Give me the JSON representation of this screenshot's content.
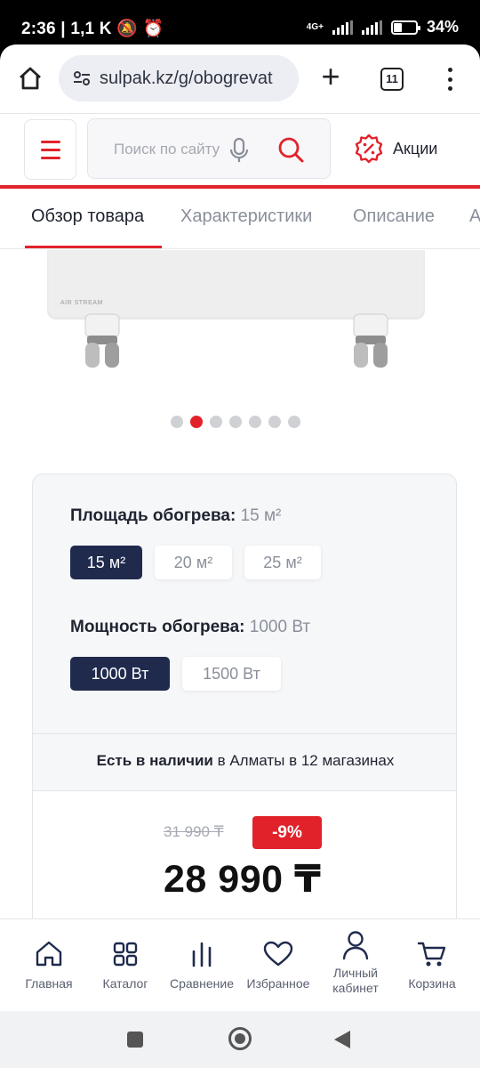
{
  "status_bar": {
    "time": "2:36",
    "network_speed": "1,1 K",
    "network_type": "4G+",
    "battery": "34%"
  },
  "browser": {
    "url": "sulpak.kz/g/obogrevat",
    "tab_count": "11"
  },
  "header": {
    "search_placeholder": "Поиск по сайту",
    "promo_label": "Акции",
    "accent_color": "#e2222b"
  },
  "tabs": [
    {
      "label": "Обзор товара",
      "active": true
    },
    {
      "label": "Характеристики",
      "active": false
    },
    {
      "label": "Описание",
      "active": false
    },
    {
      "label": "А",
      "active": false
    }
  ],
  "gallery": {
    "brand_text": "AIR STREAM",
    "total_images": 7,
    "active_index": 1
  },
  "options": {
    "area": {
      "title": "Площадь обогрева:",
      "selected": "15 м²",
      "choices": [
        "15 м²",
        "20 м²",
        "25 м²"
      ]
    },
    "power": {
      "title": "Мощность обогрева:",
      "selected": "1000 Вт",
      "choices": [
        "1000 Вт",
        "1500 Вт"
      ]
    }
  },
  "availability": {
    "status": "Есть в наличии",
    "details": "в Алматы в 12 магазинах"
  },
  "price": {
    "old": "31 990 ₸",
    "discount": "-9%",
    "current": "28 990 ₸"
  },
  "bottom_nav": [
    {
      "label": "Главная",
      "icon": "home-icon"
    },
    {
      "label": "Каталог",
      "icon": "grid-icon"
    },
    {
      "label": "Сравнение",
      "icon": "compare-icon"
    },
    {
      "label": "Избранное",
      "icon": "heart-icon"
    },
    {
      "label": "Личный\nкабинет",
      "icon": "user-icon"
    },
    {
      "label": "Корзина",
      "icon": "cart-icon"
    }
  ]
}
